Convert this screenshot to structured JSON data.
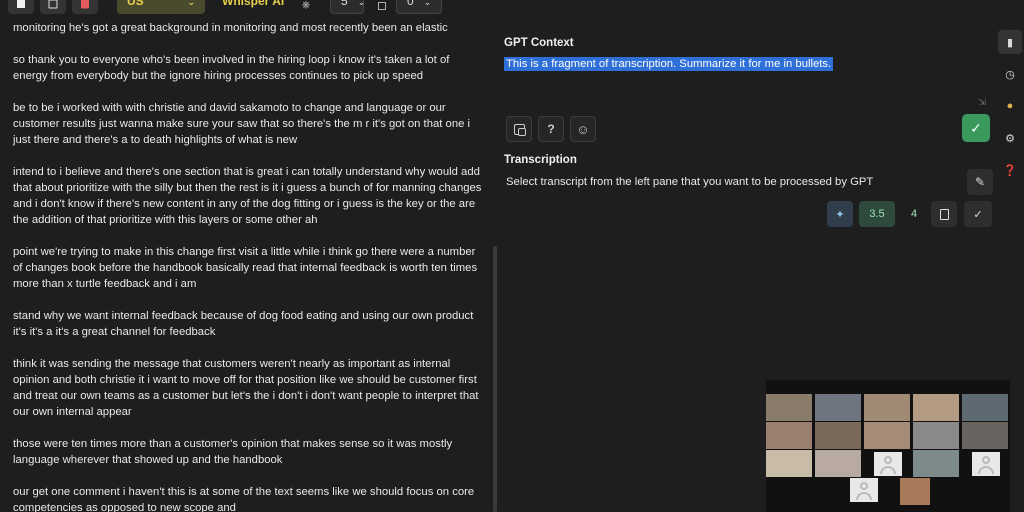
{
  "toolbar": {
    "language": "English US",
    "engine": "Whisper AI",
    "count_a": "5",
    "count_b": "0"
  },
  "transcript": {
    "paragraphs": [
      "monitoring he's got a great background in monitoring and most recently been an elastic",
      "so thank you to everyone who's been involved in the hiring loop i know it's taken a lot of energy from everybody but the ignore hiring processes continues to pick up speed",
      "be to be i worked with with christie and david sakamoto to change and language or our customer results just wanna make sure your saw that so there's the m r it's got on that one i just there and there's a to death highlights of what is new",
      "intend to i believe and there's one section that is great i can totally understand why would add that about prioritize with the silly but then the rest is it i guess a bunch of for manning changes and i don't know if there's new content in any of the dog fitting or i guess is the key or the are the addition of that prioritize with this layers or some other ah",
      "point we're trying to make in this change first visit a little while i think go there were a number of changes book before the handbook basically read that internal feedback is worth ten times more than x turtle feedback and i am",
      "stand why we want internal feedback because of dog food eating and using our own product it's it's a it's a great channel for feedback",
      "think it was sending the message that customers weren't nearly as important as internal opinion and both christie it i want to move off for that position like we should be customer first and treat our own teams as a customer but let's the i don't i don't want people to interpret that our own internal appear",
      "those were ten times more than a customer's opinion that makes sense so it was mostly language wherever that showed up and the handbook",
      "our get one comment i haven't this is at some of the text seems like we should focus on core competencies as opposed to new scope and"
    ]
  },
  "gpt_context": {
    "title": "GPT Context",
    "prompt": "This is a fragment of transcription. Summarize it for me in bullets."
  },
  "transcription": {
    "title": "Transcription",
    "placeholder": "Select transcript from the left pane that you want to be processed by GPT",
    "model_35": "3.5",
    "model_4": "4"
  },
  "colors": {
    "accent_yellow": "#e6cf4a",
    "selection_blue": "#2f6fd8",
    "confirm_green": "#3a9a5e"
  }
}
